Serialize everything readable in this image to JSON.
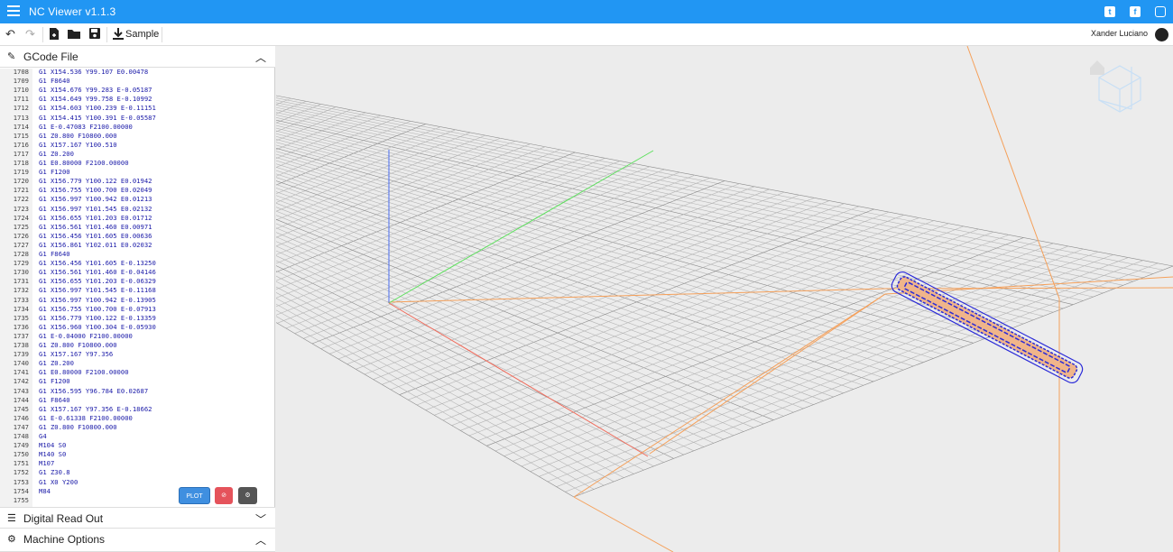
{
  "app": {
    "title": "NC Viewer  v1.1.3"
  },
  "social": [
    "twitter-icon",
    "facebook-icon",
    "instagram-icon"
  ],
  "toolbar": {
    "sample_label": "Sample",
    "user_name": "Xander Luciano"
  },
  "gcode_panel": {
    "title": "GCode File",
    "lines": [
      [
        "1708",
        "G1 X154.536 Y99.107 E0.00478"
      ],
      [
        "1709",
        "G1 F8640"
      ],
      [
        "1710",
        "G1 X154.676 Y99.283 E-0.05187"
      ],
      [
        "1711",
        "G1 X154.649 Y99.758 E-0.10992"
      ],
      [
        "1712",
        "G1 X154.603 Y100.239 E-0.11151"
      ],
      [
        "1713",
        "G1 X154.415 Y100.391 E-0.05587"
      ],
      [
        "1714",
        "G1 E-0.47083 F2100.00000"
      ],
      [
        "1715",
        "G1 Z0.800 F10800.000"
      ],
      [
        "1716",
        "G1 X157.167 Y100.510"
      ],
      [
        "1717",
        "G1 Z0.200"
      ],
      [
        "1718",
        "G1 E0.80000 F2100.00000"
      ],
      [
        "1719",
        "G1 F1200"
      ],
      [
        "1720",
        "G1 X156.779 Y100.122 E0.01942"
      ],
      [
        "1721",
        "G1 X156.755 Y100.700 E0.02049"
      ],
      [
        "1722",
        "G1 X156.997 Y100.942 E0.01213"
      ],
      [
        "1723",
        "G1 X156.997 Y101.545 E0.02132"
      ],
      [
        "1724",
        "G1 X156.655 Y101.203 E0.01712"
      ],
      [
        "1725",
        "G1 X156.561 Y101.460 E0.00971"
      ],
      [
        "1726",
        "G1 X156.456 Y101.605 E0.00636"
      ],
      [
        "1727",
        "G1 X156.861 Y102.011 E0.02032"
      ],
      [
        "1728",
        "G1 F8640"
      ],
      [
        "1729",
        "G1 X156.456 Y101.605 E-0.13250"
      ],
      [
        "1730",
        "G1 X156.561 Y101.460 E-0.04146"
      ],
      [
        "1731",
        "G1 X156.655 Y101.203 E-0.06329"
      ],
      [
        "1732",
        "G1 X156.997 Y101.545 E-0.11168"
      ],
      [
        "1733",
        "G1 X156.997 Y100.942 E-0.13905"
      ],
      [
        "1734",
        "G1 X156.755 Y100.700 E-0.07913"
      ],
      [
        "1735",
        "G1 X156.779 Y100.122 E-0.13359"
      ],
      [
        "1736",
        "G1 X156.960 Y100.304 E-0.05930"
      ],
      [
        "1737",
        "G1 E-0.04000 F2100.00000"
      ],
      [
        "1738",
        "G1 Z0.800 F10800.000"
      ],
      [
        "1739",
        "G1 X157.167 Y97.356"
      ],
      [
        "1740",
        "G1 Z0.200"
      ],
      [
        "1741",
        "G1 E0.80000 F2100.00000"
      ],
      [
        "1742",
        "G1 F1200"
      ],
      [
        "1743",
        "G1 X156.595 Y96.784 E0.02687"
      ],
      [
        "1744",
        "G1 F8640"
      ],
      [
        "1745",
        "G1 X157.167 Y97.356 E-0.18662"
      ],
      [
        "1746",
        "G1 E-0.61338 F2100.00000"
      ],
      [
        "1747",
        "G1 Z0.800 F10800.000"
      ],
      [
        "1748",
        "G4"
      ],
      [
        "1749",
        "M104 S0"
      ],
      [
        "1750",
        "M140 S0"
      ],
      [
        "1751",
        "M107"
      ],
      [
        "1752",
        "G1 Z30.8"
      ],
      [
        "1753",
        "G1 X0 Y200"
      ],
      [
        "1754",
        "M84"
      ],
      [
        "1755",
        ""
      ]
    ],
    "plot_label": "PLOT"
  },
  "dro_panel": {
    "title": "Digital Read Out"
  },
  "machine_panel": {
    "title": "Machine Options"
  },
  "colors": {
    "accent": "#2196f3",
    "code_text": "#1a1aa8",
    "path_blue": "#2a2ad8",
    "travel_orange": "#f5a05a",
    "stop_red": "#e5535b"
  }
}
